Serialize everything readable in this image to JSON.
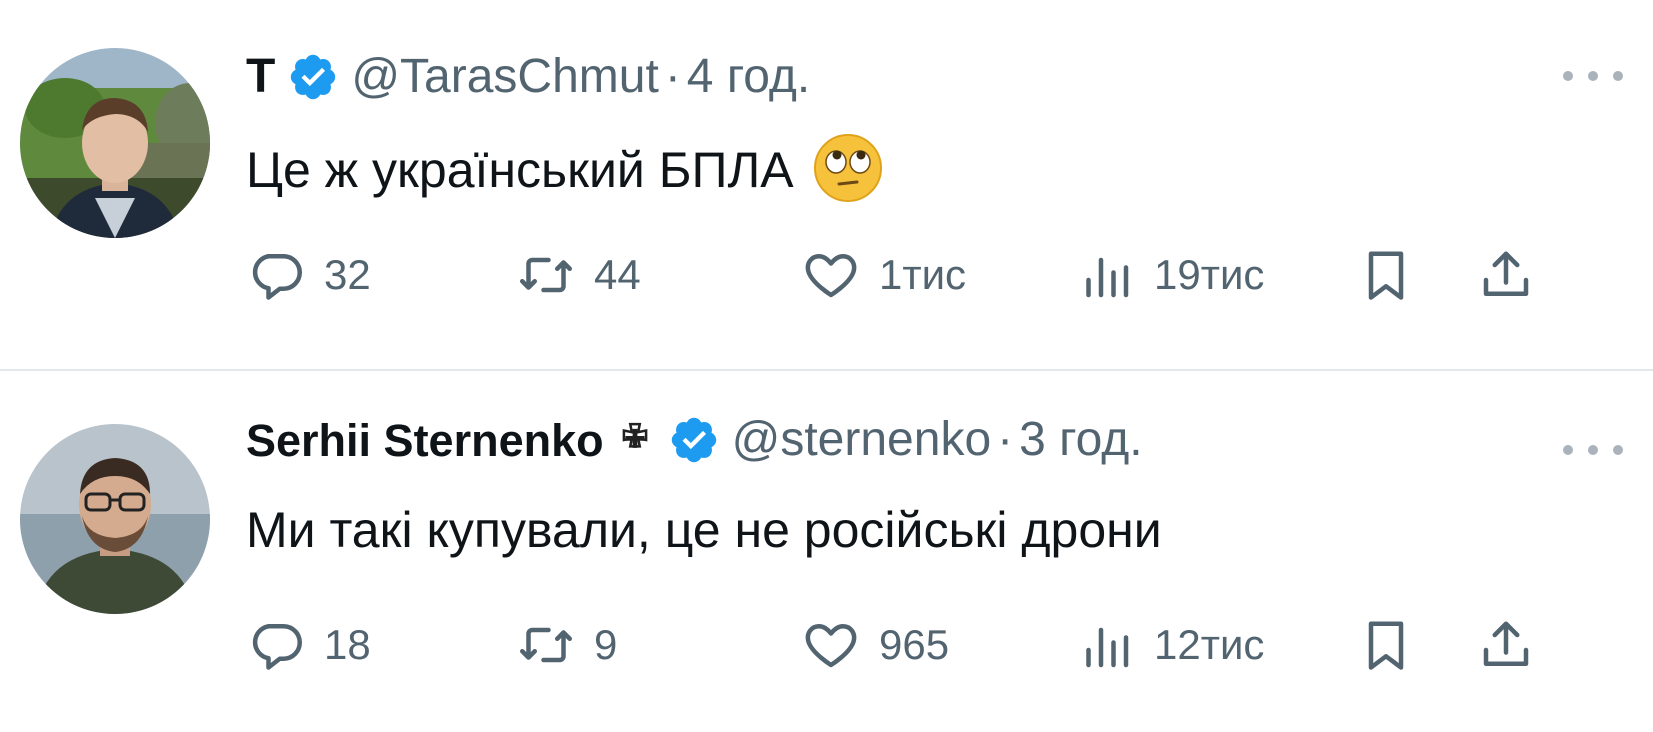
{
  "tweets": [
    {
      "name": "T",
      "verified": true,
      "handle": "@TarasChmut",
      "separator": "·",
      "time": "4 год.",
      "text": "Це ж український БПЛА",
      "emoji": "face-with-rolling-eyes",
      "stats": {
        "replies": "32",
        "retweets": "44",
        "likes": "1тис",
        "views": "19тис"
      }
    },
    {
      "name": "Serhii Sternenko",
      "verified": true,
      "handle": "@sternenko",
      "separator": "·",
      "time": "3 год.",
      "text": "Ми такі купували, це не російські дрони",
      "stats": {
        "replies": "18",
        "retweets": "9",
        "likes": "965",
        "views": "12тис"
      }
    }
  ],
  "colors": {
    "verified_badge": "#1d9bf0",
    "secondary_text": "#536471",
    "primary_text": "#0f1419",
    "divider": "#e4e7ea"
  }
}
